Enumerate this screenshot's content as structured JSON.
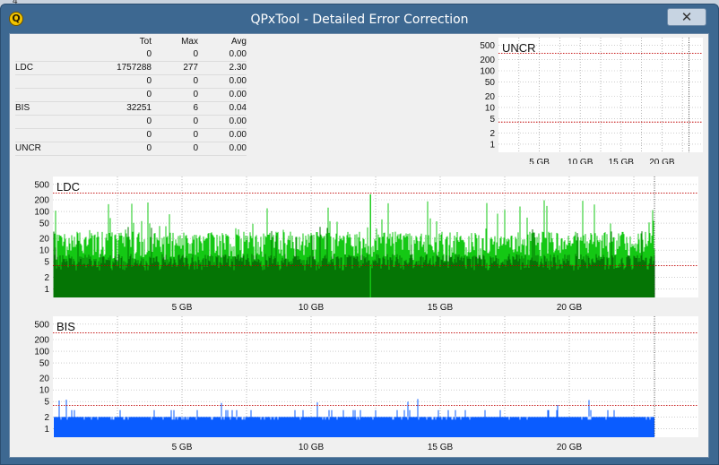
{
  "window": {
    "title": "QPxTool - Detailed Error Correction",
    "icon_letter": "Q",
    "close_glyph": "✕",
    "behind_text": "4"
  },
  "stats": {
    "headers": [
      "",
      "Tot",
      "Max",
      "Avg"
    ],
    "rows": [
      {
        "label": "",
        "tot": "0",
        "max": "0",
        "avg": "0.00"
      },
      {
        "label": "LDC",
        "tot": "1757288",
        "max": "277",
        "avg": "2.30"
      },
      {
        "label": "",
        "tot": "0",
        "max": "0",
        "avg": "0.00"
      },
      {
        "label": "",
        "tot": "0",
        "max": "0",
        "avg": "0.00"
      },
      {
        "label": "BIS",
        "tot": "32251",
        "max": "6",
        "avg": "0.04"
      },
      {
        "label": "",
        "tot": "0",
        "max": "0",
        "avg": "0.00"
      },
      {
        "label": "",
        "tot": "0",
        "max": "0",
        "avg": "0.00"
      },
      {
        "label": "UNCR",
        "tot": "0",
        "max": "0",
        "avg": "0.00"
      }
    ]
  },
  "colors": {
    "ldc_light": "#14c814",
    "ldc_dark": "#057505",
    "bis": "#0a5cff",
    "limit": "#c00000",
    "grid": "#888888",
    "panel_bg": "#ffffff"
  },
  "chart_data": [
    {
      "type": "bar",
      "label": "UNCR",
      "scale": "log",
      "y_ticks": [
        "500",
        "200",
        "100",
        "50",
        "20",
        "10",
        "5",
        "2",
        "1"
      ],
      "x_ticks": [
        "5 GB",
        "10 GB",
        "15 GB",
        "20 GB"
      ],
      "x_range_gb": [
        0,
        25
      ],
      "y_range": [
        0.6,
        800
      ],
      "limits": [
        300,
        4
      ],
      "values": []
    },
    {
      "type": "bar",
      "label": "LDC",
      "scale": "log",
      "y_ticks": [
        "500",
        "200",
        "100",
        "50",
        "20",
        "10",
        "5",
        "2",
        "1"
      ],
      "x_ticks": [
        "5 GB",
        "10 GB",
        "15 GB",
        "20 GB"
      ],
      "x_range_gb": [
        0,
        25
      ],
      "y_range": [
        0.6,
        800
      ],
      "limits": [
        300,
        4
      ],
      "data_end_gb": 23.3,
      "typical_peak": 40,
      "max": 277
    },
    {
      "type": "bar",
      "label": "BIS",
      "scale": "log",
      "y_ticks": [
        "500",
        "200",
        "100",
        "50",
        "20",
        "10",
        "5",
        "2",
        "1"
      ],
      "x_ticks": [
        "5 GB",
        "10 GB",
        "15 GB",
        "20 GB"
      ],
      "x_range_gb": [
        0,
        25
      ],
      "y_range": [
        0.6,
        800
      ],
      "limits": [
        300,
        4
      ],
      "data_end_gb": 23.3,
      "typical_value": 2,
      "max": 6
    }
  ]
}
